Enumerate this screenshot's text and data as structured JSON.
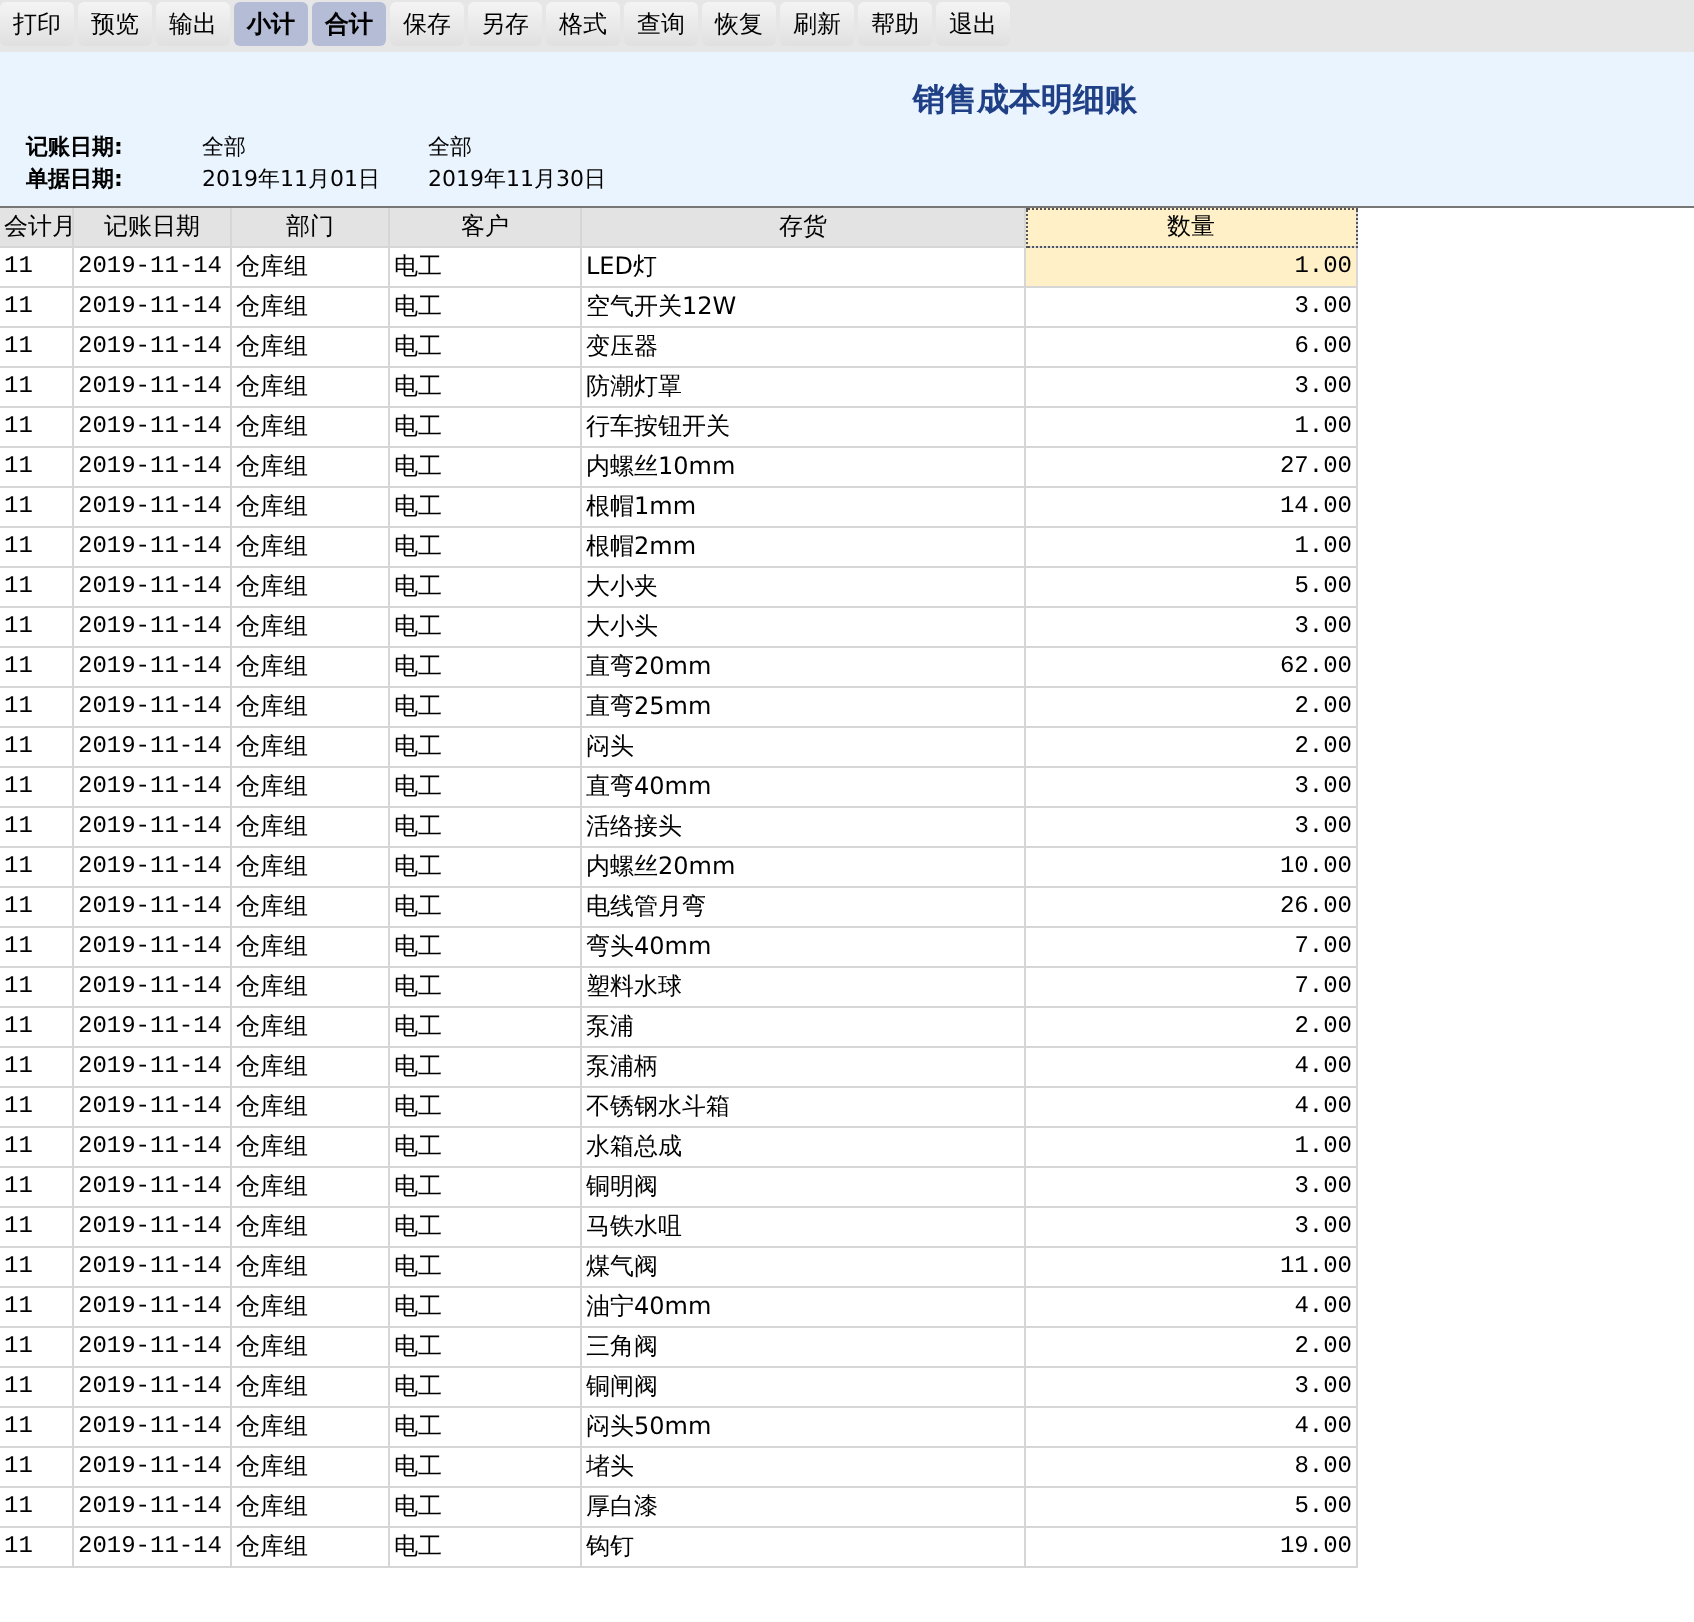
{
  "toolbar": [
    {
      "label": "打印",
      "active": false
    },
    {
      "label": "预览",
      "active": false
    },
    {
      "label": "输出",
      "active": false
    },
    {
      "label": "小计",
      "active": true
    },
    {
      "label": "合计",
      "active": true
    },
    {
      "label": "保存",
      "active": false
    },
    {
      "label": "另存",
      "active": false
    },
    {
      "label": "格式",
      "active": false
    },
    {
      "label": "查询",
      "active": false
    },
    {
      "label": "恢复",
      "active": false
    },
    {
      "label": "刷新",
      "active": false
    },
    {
      "label": "帮助",
      "active": false
    },
    {
      "label": "退出",
      "active": false
    }
  ],
  "report": {
    "title": "销售成本明细账",
    "filters": [
      {
        "label": "记账日期:",
        "from": "全部",
        "to": "全部"
      },
      {
        "label": "单据日期:",
        "from": "2019年11月01日",
        "to": "2019年11月30日"
      }
    ]
  },
  "table": {
    "columns": [
      {
        "label": "会计月",
        "selected": false
      },
      {
        "label": "记账日期",
        "selected": false
      },
      {
        "label": "部门",
        "selected": false
      },
      {
        "label": "客户",
        "selected": false
      },
      {
        "label": "存货",
        "selected": false
      },
      {
        "label": "数量",
        "selected": true
      }
    ],
    "rows": [
      {
        "cells": [
          "11",
          "2019-11-14",
          "仓库组",
          "电工",
          "LED灯",
          "1.00"
        ],
        "selected": true
      },
      {
        "cells": [
          "11",
          "2019-11-14",
          "仓库组",
          "电工",
          "空气开关12W",
          "3.00"
        ],
        "selected": false
      },
      {
        "cells": [
          "11",
          "2019-11-14",
          "仓库组",
          "电工",
          "变压器",
          "6.00"
        ],
        "selected": false
      },
      {
        "cells": [
          "11",
          "2019-11-14",
          "仓库组",
          "电工",
          "防潮灯罩",
          "3.00"
        ],
        "selected": false
      },
      {
        "cells": [
          "11",
          "2019-11-14",
          "仓库组",
          "电工",
          "行车按钮开关",
          "1.00"
        ],
        "selected": false
      },
      {
        "cells": [
          "11",
          "2019-11-14",
          "仓库组",
          "电工",
          "内螺丝10mm",
          "27.00"
        ],
        "selected": false
      },
      {
        "cells": [
          "11",
          "2019-11-14",
          "仓库组",
          "电工",
          "根帽1mm",
          "14.00"
        ],
        "selected": false
      },
      {
        "cells": [
          "11",
          "2019-11-14",
          "仓库组",
          "电工",
          "根帽2mm",
          "1.00"
        ],
        "selected": false
      },
      {
        "cells": [
          "11",
          "2019-11-14",
          "仓库组",
          "电工",
          "大小夹",
          "5.00"
        ],
        "selected": false
      },
      {
        "cells": [
          "11",
          "2019-11-14",
          "仓库组",
          "电工",
          "大小头",
          "3.00"
        ],
        "selected": false
      },
      {
        "cells": [
          "11",
          "2019-11-14",
          "仓库组",
          "电工",
          "直弯20mm",
          "62.00"
        ],
        "selected": false
      },
      {
        "cells": [
          "11",
          "2019-11-14",
          "仓库组",
          "电工",
          "直弯25mm",
          "2.00"
        ],
        "selected": false
      },
      {
        "cells": [
          "11",
          "2019-11-14",
          "仓库组",
          "电工",
          "闷头",
          "2.00"
        ],
        "selected": false
      },
      {
        "cells": [
          "11",
          "2019-11-14",
          "仓库组",
          "电工",
          "直弯40mm",
          "3.00"
        ],
        "selected": false
      },
      {
        "cells": [
          "11",
          "2019-11-14",
          "仓库组",
          "电工",
          "活络接头",
          "3.00"
        ],
        "selected": false
      },
      {
        "cells": [
          "11",
          "2019-11-14",
          "仓库组",
          "电工",
          "内螺丝20mm",
          "10.00"
        ],
        "selected": false
      },
      {
        "cells": [
          "11",
          "2019-11-14",
          "仓库组",
          "电工",
          "电线管月弯",
          "26.00"
        ],
        "selected": false
      },
      {
        "cells": [
          "11",
          "2019-11-14",
          "仓库组",
          "电工",
          "弯头40mm",
          "7.00"
        ],
        "selected": false
      },
      {
        "cells": [
          "11",
          "2019-11-14",
          "仓库组",
          "电工",
          "塑料水球",
          "7.00"
        ],
        "selected": false
      },
      {
        "cells": [
          "11",
          "2019-11-14",
          "仓库组",
          "电工",
          "泵浦",
          "2.00"
        ],
        "selected": false
      },
      {
        "cells": [
          "11",
          "2019-11-14",
          "仓库组",
          "电工",
          "泵浦柄",
          "4.00"
        ],
        "selected": false
      },
      {
        "cells": [
          "11",
          "2019-11-14",
          "仓库组",
          "电工",
          "不锈钢水斗箱",
          "4.00"
        ],
        "selected": false
      },
      {
        "cells": [
          "11",
          "2019-11-14",
          "仓库组",
          "电工",
          "水箱总成",
          "1.00"
        ],
        "selected": false
      },
      {
        "cells": [
          "11",
          "2019-11-14",
          "仓库组",
          "电工",
          "铜明阀",
          "3.00"
        ],
        "selected": false
      },
      {
        "cells": [
          "11",
          "2019-11-14",
          "仓库组",
          "电工",
          "马铁水咀",
          "3.00"
        ],
        "selected": false
      },
      {
        "cells": [
          "11",
          "2019-11-14",
          "仓库组",
          "电工",
          "煤气阀",
          "11.00"
        ],
        "selected": false
      },
      {
        "cells": [
          "11",
          "2019-11-14",
          "仓库组",
          "电工",
          "油宁40mm",
          "4.00"
        ],
        "selected": false
      },
      {
        "cells": [
          "11",
          "2019-11-14",
          "仓库组",
          "电工",
          "三角阀",
          "2.00"
        ],
        "selected": false
      },
      {
        "cells": [
          "11",
          "2019-11-14",
          "仓库组",
          "电工",
          "铜闸阀",
          "3.00"
        ],
        "selected": false
      },
      {
        "cells": [
          "11",
          "2019-11-14",
          "仓库组",
          "电工",
          "闷头50mm",
          "4.00"
        ],
        "selected": false
      },
      {
        "cells": [
          "11",
          "2019-11-14",
          "仓库组",
          "电工",
          "堵头",
          "8.00"
        ],
        "selected": false
      },
      {
        "cells": [
          "11",
          "2019-11-14",
          "仓库组",
          "电工",
          "厚白漆",
          "5.00"
        ],
        "selected": false
      },
      {
        "cells": [
          "11",
          "2019-11-14",
          "仓库组",
          "电工",
          "钩钉",
          "19.00"
        ],
        "selected": false
      }
    ]
  }
}
